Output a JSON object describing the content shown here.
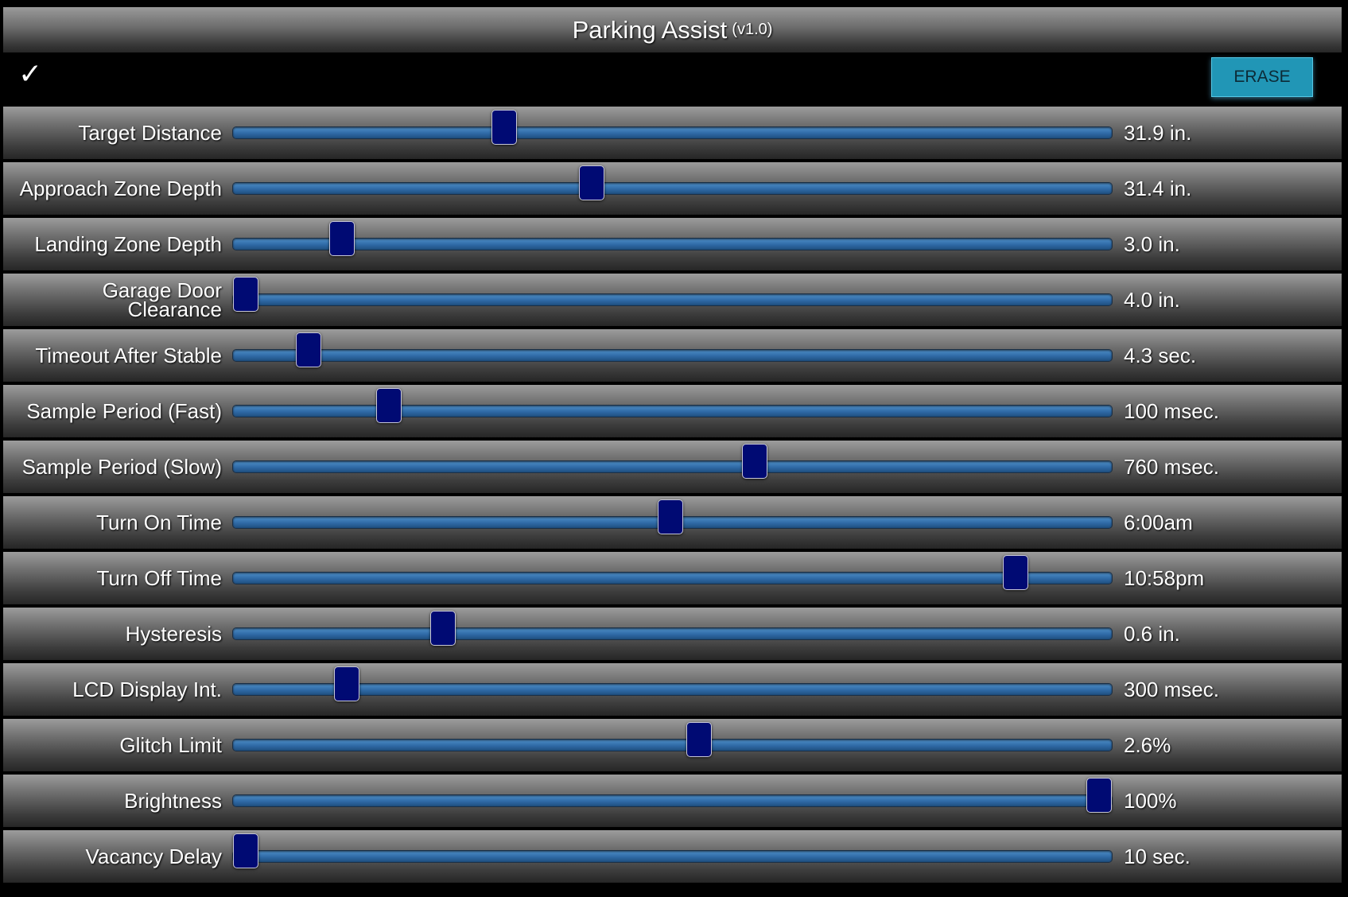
{
  "header": {
    "title": "Parking Assist",
    "version": "(v1.0)"
  },
  "toolbar": {
    "check_icon": "checkmark-icon",
    "check_glyph": "✓",
    "erase_label": "ERASE"
  },
  "colors": {
    "track": "#2f6aa6",
    "thumb": "#000a73",
    "erase_button": "#2196b6"
  },
  "sliders": [
    {
      "label": "Target Distance",
      "value": "31.9 in.",
      "fraction": 0.303
    },
    {
      "label": "Approach Zone Depth",
      "value": "31.4 in.",
      "fraction": 0.405
    },
    {
      "label": "Landing Zone Depth",
      "value": "3.0 in.",
      "fraction": 0.113
    },
    {
      "label": "Garage Door Clearance",
      "value": "4.0 in.",
      "fraction": 0.0
    },
    {
      "label": "Timeout After Stable",
      "value": "4.3 sec.",
      "fraction": 0.074
    },
    {
      "label": "Sample Period (Fast)",
      "value": "100 msec.",
      "fraction": 0.168
    },
    {
      "label": "Sample Period (Slow)",
      "value": "760 msec.",
      "fraction": 0.596
    },
    {
      "label": "Turn On Time",
      "value": "6:00am",
      "fraction": 0.498
    },
    {
      "label": "Turn Off Time",
      "value": "10:58pm",
      "fraction": 0.902
    },
    {
      "label": "Hysteresis",
      "value": "0.6 in.",
      "fraction": 0.231
    },
    {
      "label": "LCD Display Int.",
      "value": "300 msec.",
      "fraction": 0.118
    },
    {
      "label": "Glitch Limit",
      "value": "2.6%",
      "fraction": 0.531
    },
    {
      "label": "Brightness",
      "value": "100%",
      "fraction": 1.0
    },
    {
      "label": "Vacancy Delay",
      "value": "10 sec.",
      "fraction": 0.0
    }
  ]
}
